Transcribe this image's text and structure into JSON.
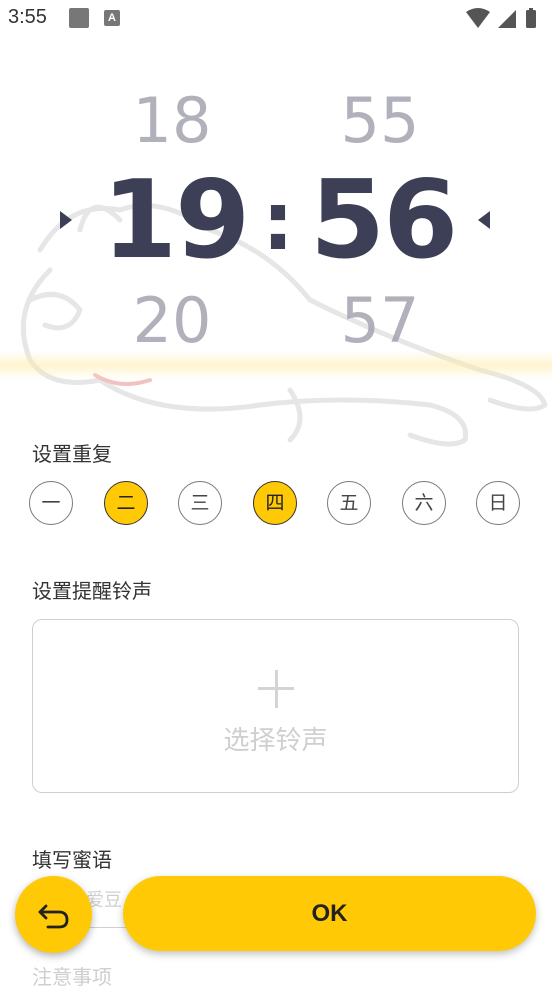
{
  "status_bar": {
    "time": "3:55",
    "icon_a": "A"
  },
  "picker": {
    "hour_prev": "18",
    "hour_current": "19",
    "hour_next": "20",
    "minute_prev": "55",
    "minute_current": "56",
    "minute_next": "57",
    "separator": ":"
  },
  "repeat": {
    "label": "设置重复",
    "days": [
      {
        "label": "一",
        "selected": false
      },
      {
        "label": "二",
        "selected": true
      },
      {
        "label": "三",
        "selected": false
      },
      {
        "label": "四",
        "selected": true
      },
      {
        "label": "五",
        "selected": false
      },
      {
        "label": "六",
        "selected": false
      },
      {
        "label": "日",
        "selected": false
      }
    ]
  },
  "ringtone": {
    "label": "设置提醒铃声",
    "select_text": "选择铃声"
  },
  "message": {
    "label": "填写蜜语",
    "placeholder": "爱豆"
  },
  "notes": {
    "label": "注意事项"
  },
  "actions": {
    "ok_label": "OK"
  },
  "colors": {
    "accent": "#ffca05",
    "digits": "#3c3f55"
  }
}
